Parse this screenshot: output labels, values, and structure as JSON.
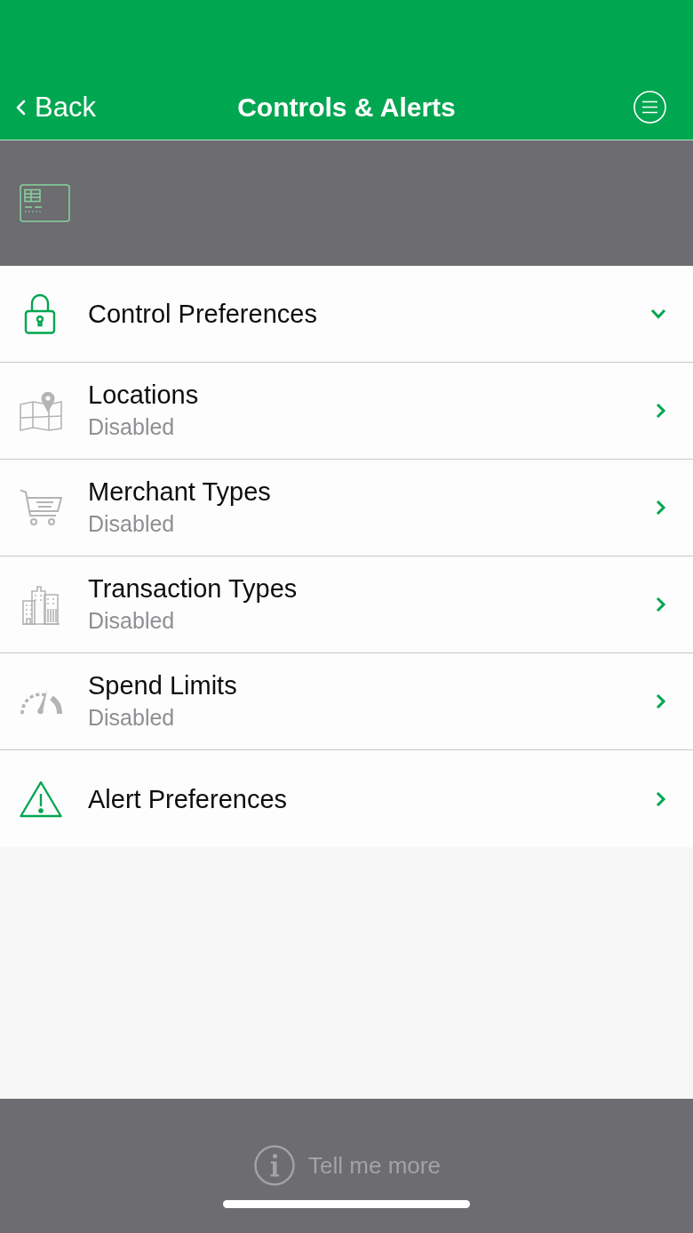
{
  "nav_bar": {
    "back_label": "Back",
    "title": "Controls & Alerts"
  },
  "items": [
    {
      "title": "Control Preferences",
      "expanded": true,
      "disabled": false
    },
    {
      "title": "Locations",
      "subtitle": "Disabled",
      "expanded": false,
      "disabled": true
    },
    {
      "title": "Merchant Types",
      "subtitle": "Disabled",
      "expanded": false,
      "disabled": true
    },
    {
      "title": "Transaction Types",
      "subtitle": "Disabled",
      "expanded": false,
      "disabled": true
    },
    {
      "title": "Spend Limits",
      "subtitle": "Disabled",
      "expanded": false,
      "disabled": true
    },
    {
      "title": "Alert Preferences",
      "expanded": false,
      "disabled": false
    }
  ],
  "footer": {
    "link": "Tell me more"
  }
}
